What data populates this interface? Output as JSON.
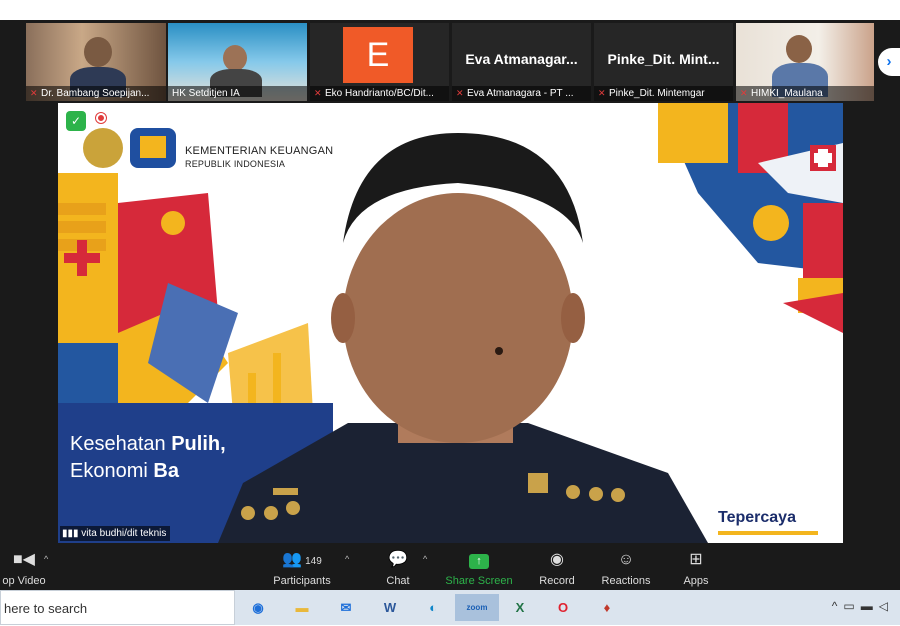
{
  "participants_strip": [
    {
      "name": "Dr. Bambang Soepijan...",
      "muted": true
    },
    {
      "name": "HK Setditjen IA",
      "muted": false
    },
    {
      "name": "Eko Handrianto/BC/Dit...",
      "muted": true,
      "avatar_letter": "E"
    },
    {
      "name": "Eva Atmanagara - PT ...",
      "muted": true,
      "title": "Eva  Atmanagar..."
    },
    {
      "name": "Pinke_Dit. Mintemgar",
      "muted": true,
      "title": "Pinke_Dit. Mint..."
    },
    {
      "name": "HIMKI_Maulana",
      "muted": true
    }
  ],
  "next_page_icon": "chevron-right-icon",
  "main_video": {
    "speaker_name": "vita budhi/dit teknis",
    "slide": {
      "org_line1": "KEMENTERIAN KEUANGAN",
      "org_line2": "REPUBLIK INDONESIA",
      "slogan_line1_a": "Kesehatan ",
      "slogan_line1_b": "Pulih,",
      "slogan_line2_a": "Ekonomi ",
      "slogan_line2_b": "Ba",
      "right_word": "Tepercaya"
    }
  },
  "toolbar": {
    "video_label": "op Video",
    "participants_count": "149",
    "participants_label": "Participants",
    "chat_label": "Chat",
    "share_label": "Share Screen",
    "record_label": "Record",
    "reactions_label": "Reactions",
    "apps_label": "Apps"
  },
  "taskbar": {
    "search_placeholder": "here to search",
    "apps": [
      "edge-legacy-icon",
      "file-explorer-icon",
      "mail-icon",
      "word-icon",
      "edge-icon",
      "zoom-icon",
      "excel-icon",
      "opera-icon",
      "game-icon"
    ]
  },
  "colors": {
    "zoom_bg": "#1a1a1a",
    "share_green": "#2db34a",
    "muted_red": "#e03b3b",
    "avatar_orange": "#f05a28"
  }
}
